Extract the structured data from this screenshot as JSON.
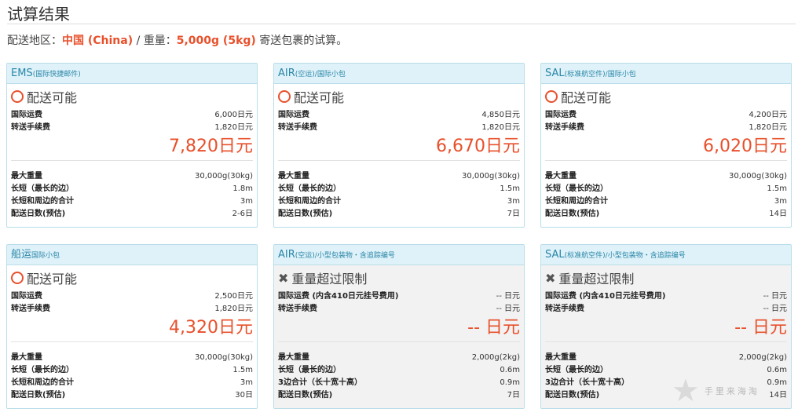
{
  "page": {
    "title": "试算结果",
    "summary": {
      "region_label": "配送地区：",
      "region_value": "中国 (China)",
      "sep": " / 重量：",
      "weight_value": "5,000g (5kg)",
      "tail": " 寄送包裹的试算。"
    }
  },
  "cards": [
    {
      "title": "EMS",
      "subtitle": "(国际快捷邮件)",
      "suffix": "",
      "status": "配送可能",
      "status_type": "ok",
      "fees": [
        {
          "label": "国际运费",
          "value": "6,000日元"
        },
        {
          "label": "转送手续费",
          "value": "1,820日元"
        }
      ],
      "total": "7,820日元",
      "specs": [
        {
          "label": "最大重量",
          "value": "30,000g(30kg)"
        },
        {
          "label": "长短（最长的边）",
          "value": "1.8m"
        },
        {
          "label": "长短和周边的合计",
          "value": "3m"
        },
        {
          "label": "配送日数(预估)",
          "value": "2-6日"
        }
      ]
    },
    {
      "title": "AIR",
      "subtitle": "(空运)",
      "suffix": "/国际小包",
      "status": "配送可能",
      "status_type": "ok",
      "fees": [
        {
          "label": "国际运费",
          "value": "4,850日元"
        },
        {
          "label": "转送手续费",
          "value": "1,820日元"
        }
      ],
      "total": "6,670日元",
      "specs": [
        {
          "label": "最大重量",
          "value": "30,000g(30kg)"
        },
        {
          "label": "长短（最长的边）",
          "value": "1.5m"
        },
        {
          "label": "长短和周边的合计",
          "value": "3m"
        },
        {
          "label": "配送日数(预估)",
          "value": "7日"
        }
      ]
    },
    {
      "title": "SAL",
      "subtitle": "(标准航空件)",
      "suffix": "/国际小包",
      "status": "配送可能",
      "status_type": "ok",
      "fees": [
        {
          "label": "国际运费",
          "value": "4,200日元"
        },
        {
          "label": "转送手续费",
          "value": "1,820日元"
        }
      ],
      "total": "6,020日元",
      "specs": [
        {
          "label": "最大重量",
          "value": "30,000g(30kg)"
        },
        {
          "label": "长短（最长的边）",
          "value": "1.5m"
        },
        {
          "label": "长短和周边的合计",
          "value": "3m"
        },
        {
          "label": "配送日数(预估)",
          "value": "14日"
        }
      ]
    },
    {
      "title": "船运",
      "subtitle": "",
      "suffix": "国际小包",
      "status": "配送可能",
      "status_type": "ok",
      "fees": [
        {
          "label": "国际运费",
          "value": "2,500日元"
        },
        {
          "label": "转送手续费",
          "value": "1,820日元"
        }
      ],
      "total": "4,320日元",
      "specs": [
        {
          "label": "最大重量",
          "value": "30,000g(30kg)"
        },
        {
          "label": "长短（最长的边）",
          "value": "1.5m"
        },
        {
          "label": "长短和周边的合计",
          "value": "3m"
        },
        {
          "label": "配送日数(预估)",
          "value": "30日"
        }
      ]
    },
    {
      "title": "AIR",
      "subtitle": "(空运)",
      "suffix": "/小型包装物・含追踪编号",
      "status": "重量超过限制",
      "status_type": "ng",
      "fees": [
        {
          "label": "国际运费 (内含410日元挂号费用)",
          "value": "-- 日元"
        },
        {
          "label": "转送手续费",
          "value": "-- 日元"
        }
      ],
      "total": "-- 日元",
      "specs": [
        {
          "label": "最大重量",
          "value": "2,000g(2kg)"
        },
        {
          "label": "长短（最长的边）",
          "value": "0.6m"
        },
        {
          "label": "3边合计（长十宽十高）",
          "value": "0.9m"
        },
        {
          "label": "配送日数(预估)",
          "value": "7日"
        }
      ]
    },
    {
      "title": "SAL",
      "subtitle": "(标准航空件)",
      "suffix": "/小型包装物・含追踪编号",
      "status": "重量超过限制",
      "status_type": "ng",
      "fees": [
        {
          "label": "国际运费 (内含410日元挂号费用)",
          "value": "-- 日元"
        },
        {
          "label": "转送手续费",
          "value": "-- 日元"
        }
      ],
      "total": "-- 日元",
      "specs": [
        {
          "label": "最大重量",
          "value": "2,000g(2kg)"
        },
        {
          "label": "长短（最长的边）",
          "value": "0.6m"
        },
        {
          "label": "3边合计（长十宽十高）",
          "value": "0.9m"
        },
        {
          "label": "配送日数(预估)",
          "value": "14日"
        }
      ]
    }
  ],
  "watermark": {
    "text": "手里来海淘",
    "icon": "star-icon"
  },
  "colors": {
    "accent": "#e8502b",
    "header_bg": "#dff2f9",
    "header_text": "#2a86a8",
    "border": "#b9dde9"
  }
}
